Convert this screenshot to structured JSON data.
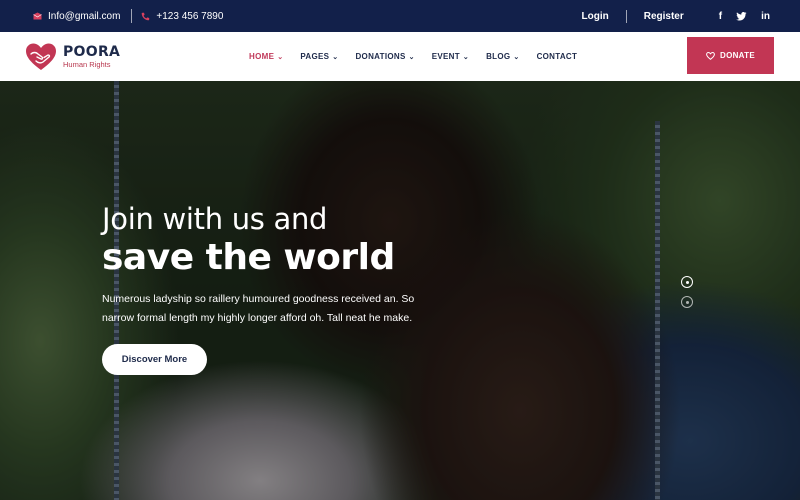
{
  "topbar": {
    "email": "Info@gmail.com",
    "phone": "+123 456 7890",
    "login": "Login",
    "register": "Register",
    "social": [
      "f",
      "t",
      "in"
    ]
  },
  "brand": {
    "name": "POORA",
    "tagline": "Human Rights"
  },
  "nav": {
    "items": [
      {
        "label": "HOME",
        "active": true,
        "has_dropdown": true
      },
      {
        "label": "PAGES",
        "active": false,
        "has_dropdown": true
      },
      {
        "label": "DONATIONS",
        "active": false,
        "has_dropdown": true
      },
      {
        "label": "EVENT",
        "active": false,
        "has_dropdown": true
      },
      {
        "label": "BLOG",
        "active": false,
        "has_dropdown": true
      },
      {
        "label": "CONTACT",
        "active": false,
        "has_dropdown": false
      }
    ],
    "donate_label": "DONATE"
  },
  "hero": {
    "line1": "Join with us and",
    "line2": "save the world",
    "description": "Numerous ladyship so raillery humoured goodness received an. So narrow formal length my highly longer afford oh. Tall neat he make.",
    "cta_label": "Discover More",
    "slides_total": 2,
    "active_slide": 1
  },
  "colors": {
    "topbar_bg": "#12204a",
    "accent": "#c23654",
    "nav_text": "#1e2a4a"
  }
}
